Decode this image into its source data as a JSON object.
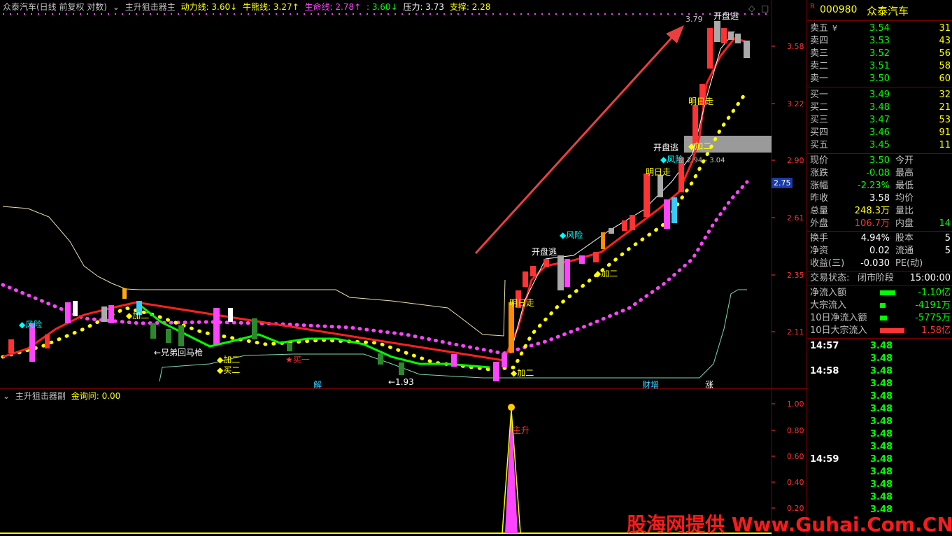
{
  "header": {
    "title": "众泰汽车(日线 前复权 对数)",
    "indicator": "主升狙击器主",
    "dongli_label": "动力线: ",
    "dongli_value": "3.60↓",
    "niuxiong_label": "牛熊线: ",
    "niuxiong_value": "3.27↑",
    "shengming_label": "生命线: ",
    "shengming_value": "2.78↑",
    "shengming_extra": " : 3.60↓",
    "yali": "压力: 3.73",
    "zhicheng": "支撑: 2.28"
  },
  "sub_header": {
    "indicator": "主升狙击器副",
    "value": "金询问: 0.00"
  },
  "price_axis": [
    "3.58",
    "3.22",
    "2.90",
    "2.75",
    "2.61",
    "2.35",
    "2.11"
  ],
  "sub_axis": [
    "1.00",
    "0.80",
    "0.60",
    "0.40",
    "0.20"
  ],
  "annotations": {
    "fengxian1": "◆风险",
    "fengxian2": "◆风险",
    "fengxian3": "◆风险",
    "jiaer": "◆加二",
    "xiongdi": "←兄弟回马枪",
    "mairyi": "★买一",
    "maier": "◆买二",
    "low": "←1.93",
    "jie": "解",
    "caizeng": "财增",
    "zhang": "涨",
    "mingri1": "明日走",
    "mingri2": "明日走",
    "mingri3": "明日走",
    "kaipan1": "开盘逃",
    "kaipan2": "开盘逃",
    "kaipan3": "开盘逃",
    "high": "3.79",
    "range": "2.94 - 3.04",
    "zhusheng": "主升"
  },
  "quote": {
    "code": "000980",
    "name": "众泰汽车",
    "r_mark": "R",
    "asks": [
      {
        "label": "卖五",
        "price": "3.54",
        "vol": "31"
      },
      {
        "label": "卖四",
        "price": "3.53",
        "vol": "43"
      },
      {
        "label": "卖三",
        "price": "3.52",
        "vol": "56"
      },
      {
        "label": "卖二",
        "price": "3.51",
        "vol": "58"
      },
      {
        "label": "卖一",
        "price": "3.50",
        "vol": "60"
      }
    ],
    "bids": [
      {
        "label": "买一",
        "price": "3.49",
        "vol": "32"
      },
      {
        "label": "买二",
        "price": "3.48",
        "vol": "21"
      },
      {
        "label": "买三",
        "price": "3.47",
        "vol": "53"
      },
      {
        "label": "买四",
        "price": "3.46",
        "vol": "91"
      },
      {
        "label": "买五",
        "price": "3.45",
        "vol": "11"
      }
    ],
    "stats": [
      {
        "l": "现价",
        "v": "3.50",
        "l2": "今开"
      },
      {
        "l": "涨跌",
        "v": "-0.08",
        "l2": "最高"
      },
      {
        "l": "涨幅",
        "v": "-2.23%",
        "l2": "最低"
      },
      {
        "l": "昨收",
        "v": "3.58",
        "l2": "均价"
      },
      {
        "l": "总量",
        "v": "248.3万",
        "l2": "量比"
      },
      {
        "l": "外盘",
        "v": "106.7万",
        "l2": "内盘",
        "v2": "14"
      }
    ],
    "stats2": [
      {
        "l": "换手",
        "v": "4.94%",
        "l2": "股本",
        "v2": "5"
      },
      {
        "l": "净资",
        "v": "0.02",
        "l2": "流通",
        "v2": "5"
      },
      {
        "l": "收益(三)",
        "v": "-0.030",
        "l2": "PE(动)"
      }
    ],
    "trade_status_label": "交易状态:",
    "trade_status": "闭市阶段",
    "trade_time": "15:00:00",
    "flows": [
      {
        "l": "净流入额",
        "v": "-1.10亿",
        "color": "#00ff00",
        "w": 22
      },
      {
        "l": "大宗流入",
        "v": "-4191万",
        "color": "#00ff00",
        "w": 8
      },
      {
        "l": "10日净流入额",
        "v": "-5775万",
        "color": "#00ff00",
        "w": 10
      },
      {
        "l": "10日大宗流入",
        "v": "1.58亿",
        "color": "#ff3333",
        "w": 35
      }
    ],
    "ticks": [
      {
        "t": "14:57",
        "p": "3.48"
      },
      {
        "t": "",
        "p": "3.48"
      },
      {
        "t": "14:58",
        "p": "3.48"
      },
      {
        "t": "",
        "p": "3.48"
      },
      {
        "t": "",
        "p": "3.48"
      },
      {
        "t": "",
        "p": "3.48"
      },
      {
        "t": "",
        "p": "3.48"
      },
      {
        "t": "",
        "p": "3.48"
      },
      {
        "t": "",
        "p": "3.48"
      },
      {
        "t": "14:59",
        "p": "3.48"
      },
      {
        "t": "",
        "p": "3.48"
      },
      {
        "t": "",
        "p": "3.48"
      },
      {
        "t": "",
        "p": "3.48"
      },
      {
        "t": "",
        "p": "3.48"
      }
    ]
  },
  "watermark": "股海网提供 Www.Guhai.Com.CN",
  "colors": {
    "up": "#ff3333",
    "down": "#00ff00",
    "magenta": "#ff44ff",
    "yellow": "#ffff00",
    "cyan": "#00ffff"
  }
}
